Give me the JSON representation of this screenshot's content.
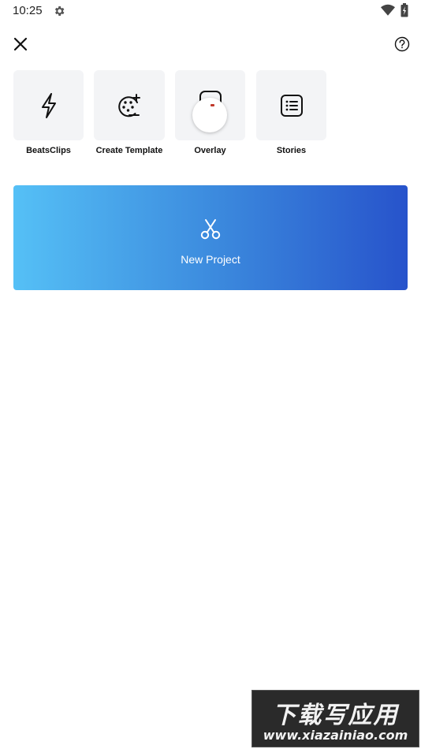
{
  "status_bar": {
    "time": "10:25",
    "icons": [
      "gear-icon",
      "wifi-icon",
      "battery-charging-icon"
    ]
  },
  "top_bar": {
    "close_icon": "close-icon",
    "help_icon": "help-icon"
  },
  "tools": [
    {
      "label": "BeatsClips",
      "icon": "lightning-icon"
    },
    {
      "label": "Create Template",
      "icon": "film-reel-plus-icon"
    },
    {
      "label": "Overlay",
      "icon": "overlay-icon"
    },
    {
      "label": "Stories",
      "icon": "list-icon"
    }
  ],
  "new_project": {
    "label": "New Project",
    "icon": "scissors-icon",
    "gradient": [
      "#55c0f6",
      "#3a86dc",
      "#2753cb"
    ]
  },
  "watermark": {
    "text": "下载写应用",
    "url": "www.xiazainiao.com"
  },
  "colors": {
    "tile_bg": "#f3f4f6",
    "text": "#111111"
  }
}
